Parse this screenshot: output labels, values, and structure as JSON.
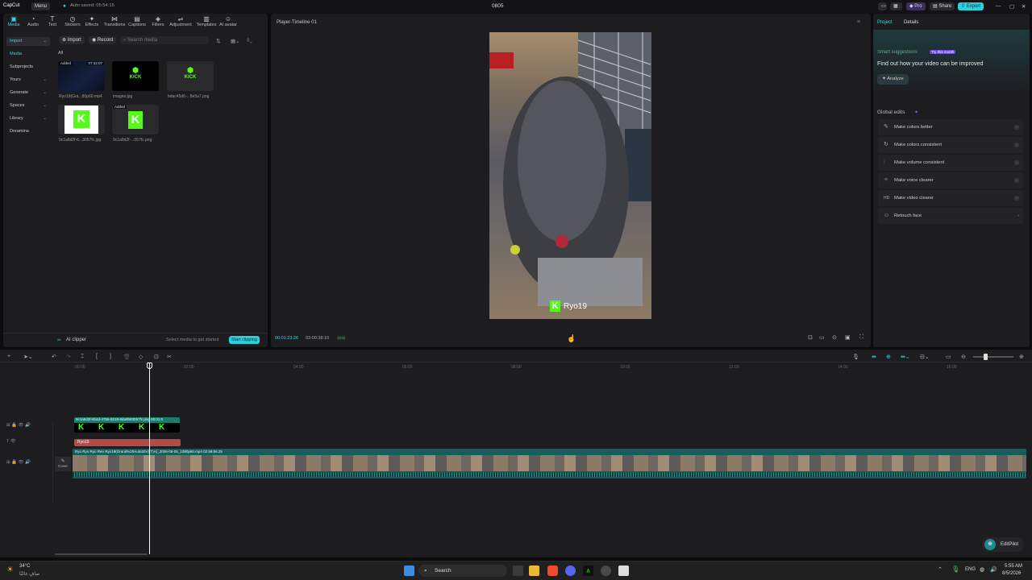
{
  "titlebar": {
    "app_name": "CapCut",
    "menu_label": "Menu",
    "autosave": "Auto saved: 05:54:15",
    "project_title": "0805",
    "pro_label": "Pro",
    "share_label": "Share",
    "export_label": "Export"
  },
  "toolbar": {
    "items": [
      {
        "label": "Media",
        "icon": "▣"
      },
      {
        "label": "Audio",
        "icon": "◔"
      },
      {
        "label": "Text",
        "icon": "T"
      },
      {
        "label": "Stickers",
        "icon": "◷"
      },
      {
        "label": "Effects",
        "icon": "✦"
      },
      {
        "label": "Transitions",
        "icon": "⋈"
      },
      {
        "label": "Captions",
        "icon": "▤"
      },
      {
        "label": "Filters",
        "icon": "◈"
      },
      {
        "label": "Adjustment",
        "icon": "⇌"
      },
      {
        "label": "Templates",
        "icon": "▥"
      },
      {
        "label": "AI avatar",
        "icon": "☺"
      }
    ]
  },
  "leftnav": {
    "items": [
      {
        "label": "Import",
        "chevron": "⌄"
      },
      {
        "label": "Media",
        "chevron": ""
      },
      {
        "label": "Subprojects",
        "chevron": ""
      },
      {
        "label": "Yours",
        "chevron": "⌄"
      },
      {
        "label": "Generate",
        "chevron": "⌄"
      },
      {
        "label": "Spaces",
        "chevron": "⌄"
      },
      {
        "label": "Library",
        "chevron": "⌄"
      },
      {
        "label": "Dreamina",
        "chevron": ""
      }
    ]
  },
  "media": {
    "import_label": "Import",
    "record_label": "Record",
    "search_placeholder": "Search media",
    "filter_all": "All",
    "files": [
      {
        "name": "Ryo19(Gra...80p60.mp4",
        "badge": "Added",
        "duration": "07:32:07"
      },
      {
        "name": "images.jpg",
        "badge": "",
        "duration": ""
      },
      {
        "name": "bdac45d6-...8e5a7.png",
        "badge": "",
        "duration": ""
      },
      {
        "name": "9c1a8d2f-6...3057fc.jpg",
        "badge": "",
        "duration": ""
      },
      {
        "name": "9c1a8d2f-...057fc.png",
        "badge": "Added",
        "duration": ""
      }
    ],
    "kick_logo_text": "KICK",
    "ai_clipper_label": "AI clipper",
    "clipper_hint": "Select media to get started",
    "start_clipping": "Start clipping"
  },
  "player": {
    "title": "Player-Timeline 01",
    "current_time": "00:01:23:26",
    "total_time": "03:00:38:10",
    "overlay_text": "Ryo19"
  },
  "right": {
    "tab_project": "Project",
    "tab_details": "Details",
    "smart_title": "Smart suggestions",
    "smart_badge": "Try this month",
    "smart_desc": "Find out how your video can be improved",
    "analyze": "Analyze",
    "global_title": "Global edits",
    "edits": [
      {
        "label": "Make colors better",
        "icon": "✎"
      },
      {
        "label": "Make colors consistent",
        "icon": "↻"
      },
      {
        "label": "Make volume consistent",
        "icon": "⫶"
      },
      {
        "label": "Make voice clearer",
        "icon": "✧"
      },
      {
        "label": "Make video clearer",
        "icon": "HD"
      },
      {
        "label": "Retouch face",
        "icon": "☺"
      }
    ]
  },
  "timeline": {
    "ticks": [
      "00:00",
      "02:00",
      "04:00",
      "06:00",
      "08:00",
      "10:00",
      "12:00",
      "14:00",
      "16:00"
    ],
    "sticker_clip": "9c1a8d2f-6b4d-4756-9218-8da9b93057fc.png  00:01:0",
    "text_clip": "Ryo19",
    "video_clip": "Ryo  Ryo    Ryo  Ren  Ryo19(Grand%20Auto20V)(T)A)_2026-08-05_1080p60.mp4  02:59:56:25",
    "cover_label": "Cover",
    "editpilot": "EditPilot"
  },
  "taskbar": {
    "weather_temp": "34°C",
    "weather_desc": "صافٍ غالبًا",
    "search_label": "Search",
    "lang": "ENG",
    "time": "5:55 AM",
    "date": "8/5/2026"
  },
  "colors": {
    "accent": "#3bd4e3",
    "kick_green": "#53fc18",
    "panel": "#1d1d20",
    "export_bg": "#2bd0e0"
  }
}
